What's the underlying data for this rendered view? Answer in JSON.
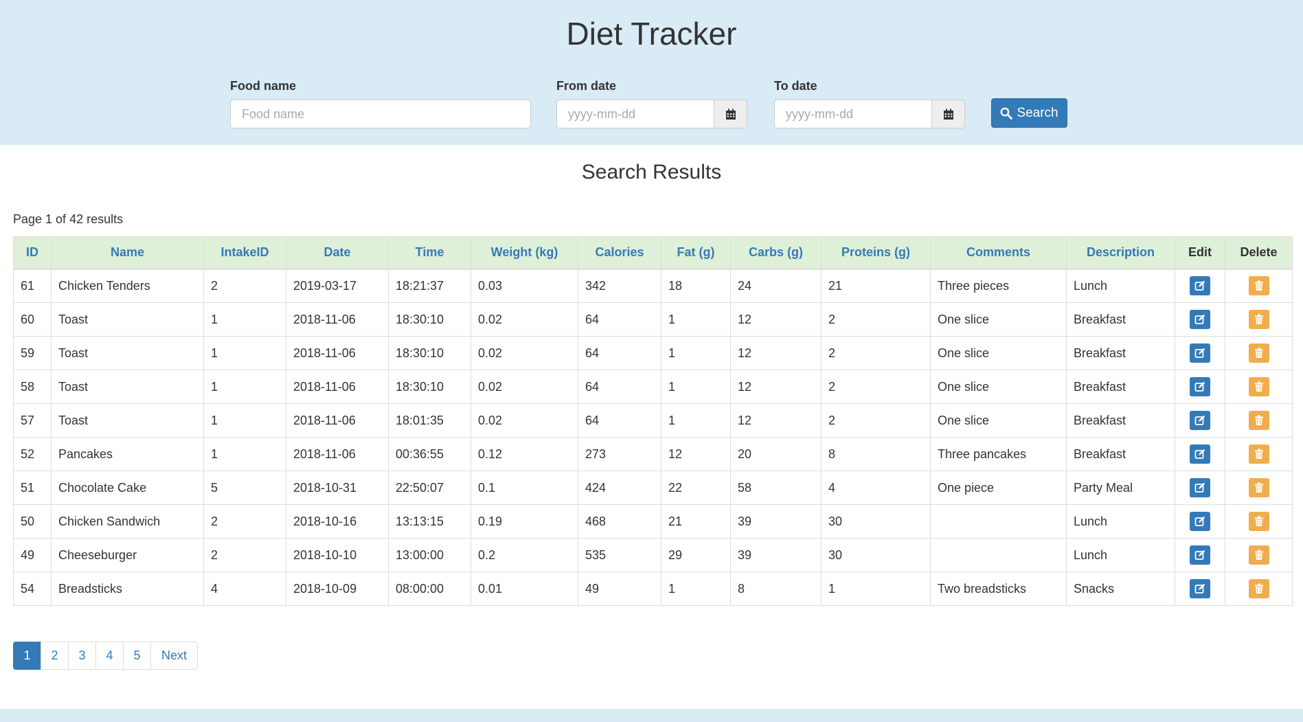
{
  "app": {
    "title": "Diet Tracker"
  },
  "search": {
    "food_name_label": "Food name",
    "food_name_placeholder": "Food name",
    "food_name_value": "",
    "from_date_label": "From date",
    "from_date_placeholder": "yyyy-mm-dd",
    "to_date_label": "To date",
    "to_date_placeholder": "yyyy-mm-dd",
    "button_label": "Search",
    "calendar_icon": "calendar-icon",
    "search_icon": "search-icon"
  },
  "results": {
    "title": "Search Results",
    "page_info": "Page 1 of 42 results",
    "columns": [
      "ID",
      "Name",
      "IntakeID",
      "Date",
      "Time",
      "Weight (kg)",
      "Calories",
      "Fat (g)",
      "Carbs (g)",
      "Proteins (g)",
      "Comments",
      "Description",
      "Edit",
      "Delete"
    ],
    "rows": [
      [
        "61",
        "Chicken Tenders",
        "2",
        "2019-03-17",
        "18:21:37",
        "0.03",
        "342",
        "18",
        "24",
        "21",
        "Three pieces",
        "Lunch"
      ],
      [
        "60",
        "Toast",
        "1",
        "2018-11-06",
        "18:30:10",
        "0.02",
        "64",
        "1",
        "12",
        "2",
        "One slice",
        "Breakfast"
      ],
      [
        "59",
        "Toast",
        "1",
        "2018-11-06",
        "18:30:10",
        "0.02",
        "64",
        "1",
        "12",
        "2",
        "One slice",
        "Breakfast"
      ],
      [
        "58",
        "Toast",
        "1",
        "2018-11-06",
        "18:30:10",
        "0.02",
        "64",
        "1",
        "12",
        "2",
        "One slice",
        "Breakfast"
      ],
      [
        "57",
        "Toast",
        "1",
        "2018-11-06",
        "18:01:35",
        "0.02",
        "64",
        "1",
        "12",
        "2",
        "One slice",
        "Breakfast"
      ],
      [
        "52",
        "Pancakes",
        "1",
        "2018-11-06",
        "00:36:55",
        "0.12",
        "273",
        "12",
        "20",
        "8",
        "Three pancakes",
        "Breakfast"
      ],
      [
        "51",
        "Chocolate Cake",
        "5",
        "2018-10-31",
        "22:50:07",
        "0.1",
        "424",
        "22",
        "58",
        "4",
        "One piece",
        "Party Meal"
      ],
      [
        "50",
        "Chicken Sandwich",
        "2",
        "2018-10-16",
        "13:13:15",
        "0.19",
        "468",
        "21",
        "39",
        "30",
        "",
        "Lunch"
      ],
      [
        "49",
        "Cheeseburger",
        "2",
        "2018-10-10",
        "13:00:00",
        "0.2",
        "535",
        "29",
        "39",
        "30",
        "",
        "Lunch"
      ],
      [
        "54",
        "Breadsticks",
        "4",
        "2018-10-09",
        "08:00:00",
        "0.01",
        "49",
        "1",
        "8",
        "1",
        "Two breadsticks",
        "Snacks"
      ]
    ],
    "edit_icon": "edit-icon",
    "delete_icon": "trash-icon"
  },
  "pagination": {
    "pages": [
      "1",
      "2",
      "3",
      "4",
      "5"
    ],
    "active": "1",
    "next_label": "Next"
  },
  "colors": {
    "header_bg": "#d9ebf5",
    "primary": "#337ab7",
    "warning": "#f0ad4e",
    "table_header_bg": "#dff0d8"
  }
}
